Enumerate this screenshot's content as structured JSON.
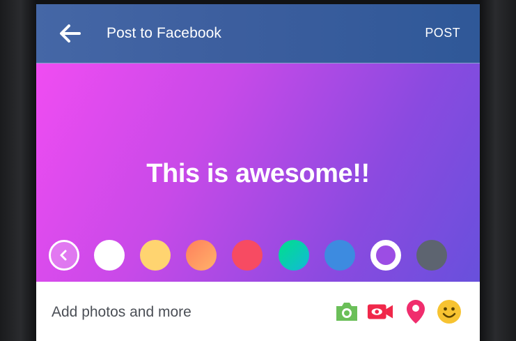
{
  "header": {
    "title": "Post to Facebook",
    "post_label": "POST",
    "icon": "back-arrow-icon",
    "background": "#3b5998"
  },
  "composer": {
    "text": "This is awesome!!",
    "background_gradient": [
      "#f04cf2",
      "#6850dc"
    ],
    "swatches": [
      {
        "name": "collapse-swatches",
        "icon": "chevron-left-icon"
      },
      {
        "name": "white",
        "color": "#ffffff"
      },
      {
        "name": "yellow",
        "color": "#ffd470"
      },
      {
        "name": "orange-gradient",
        "color": "#ff8f6b"
      },
      {
        "name": "red",
        "color": "#f74b62"
      },
      {
        "name": "teal-gradient",
        "color": "#16c9a6"
      },
      {
        "name": "blue",
        "color": "#3d8be0"
      },
      {
        "name": "selected-purple",
        "color": "#9c4de4",
        "selected": true
      },
      {
        "name": "slate",
        "color": "#5d6470"
      }
    ]
  },
  "bottom_bar": {
    "label": "Add photos and more",
    "icons": [
      {
        "name": "camera-icon",
        "color": "#6bbf59"
      },
      {
        "name": "live-video-icon",
        "color": "#f0284a"
      },
      {
        "name": "location-pin-icon",
        "color": "#f02d6d"
      },
      {
        "name": "smiley-icon",
        "color": "#f7c331"
      }
    ]
  }
}
